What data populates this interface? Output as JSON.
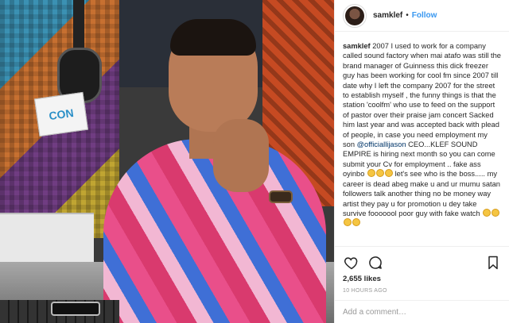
{
  "photo": {
    "mic_flag_text": "CON",
    "description_icon": "studio-photo"
  },
  "header": {
    "username": "samklef",
    "separator": "•",
    "follow_label": "Follow"
  },
  "caption": {
    "username": "samklef",
    "text_part1": "2007 I used to work for a company called sound factory when mai atafo was still the brand manager of Guinness this dick freezer guy has been working for cool fm since 2007 till date why I left the company 2007 for the street to establish myself , the funny things is that the station 'coolfm' who use to feed on the support of pastor over their praise jam concert Sacked him last year and was accepted back with plead of people, in case you need employment my son",
    "mention": "@officiallijason",
    "text_part2": "CEO...KLEF SOUND EMPIRE is hiring next month so you can come submit your Cv for employment .. fake ass oyinbo",
    "text_part3": "let's see who is the boss..... my career is dead abeg make u and ur mumu satan followers talk another thing no be money way artist they pay u for promotion u dey take survive fooooool poor guy with fake watch"
  },
  "actions": {
    "like_icon": "heart-icon",
    "comment_icon": "comment-icon",
    "save_icon": "bookmark-icon"
  },
  "likes_text": "2,655 likes",
  "time_text": "10 HOURS AGO",
  "comment": {
    "placeholder": "Add a comment…"
  },
  "colors": {
    "follow": "#3897f0",
    "mention": "#003569",
    "muted": "#999999"
  }
}
